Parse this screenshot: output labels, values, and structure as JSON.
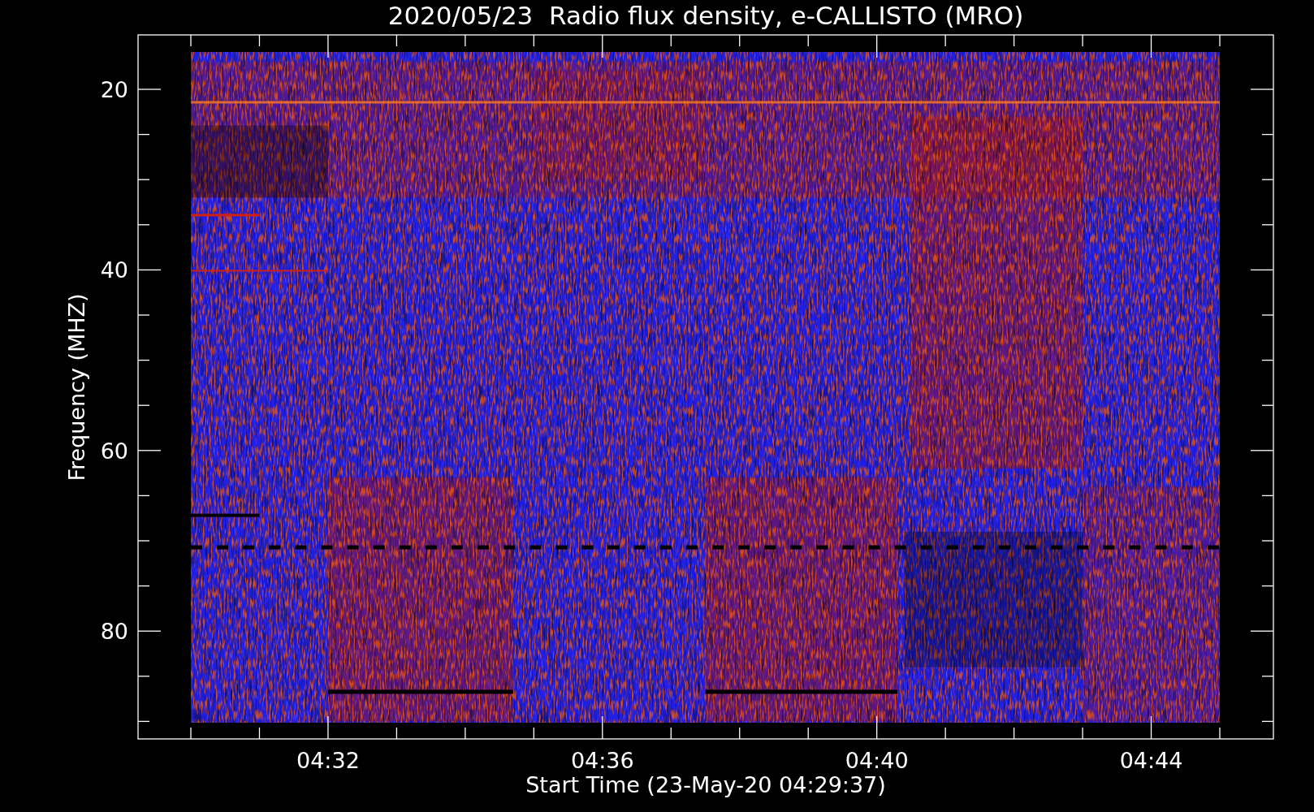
{
  "title": "2020/05/23  Radio flux density, e-CALLISTO (MRO)",
  "y_axis": {
    "label": "Frequency (MHZ)",
    "ticks": [
      "20",
      "40",
      "60",
      "80"
    ]
  },
  "x_axis": {
    "label": "Start Time (23-May-20 04:29:37)",
    "ticks": [
      "04:32",
      "04:36",
      "04:40",
      "04:44"
    ]
  }
}
